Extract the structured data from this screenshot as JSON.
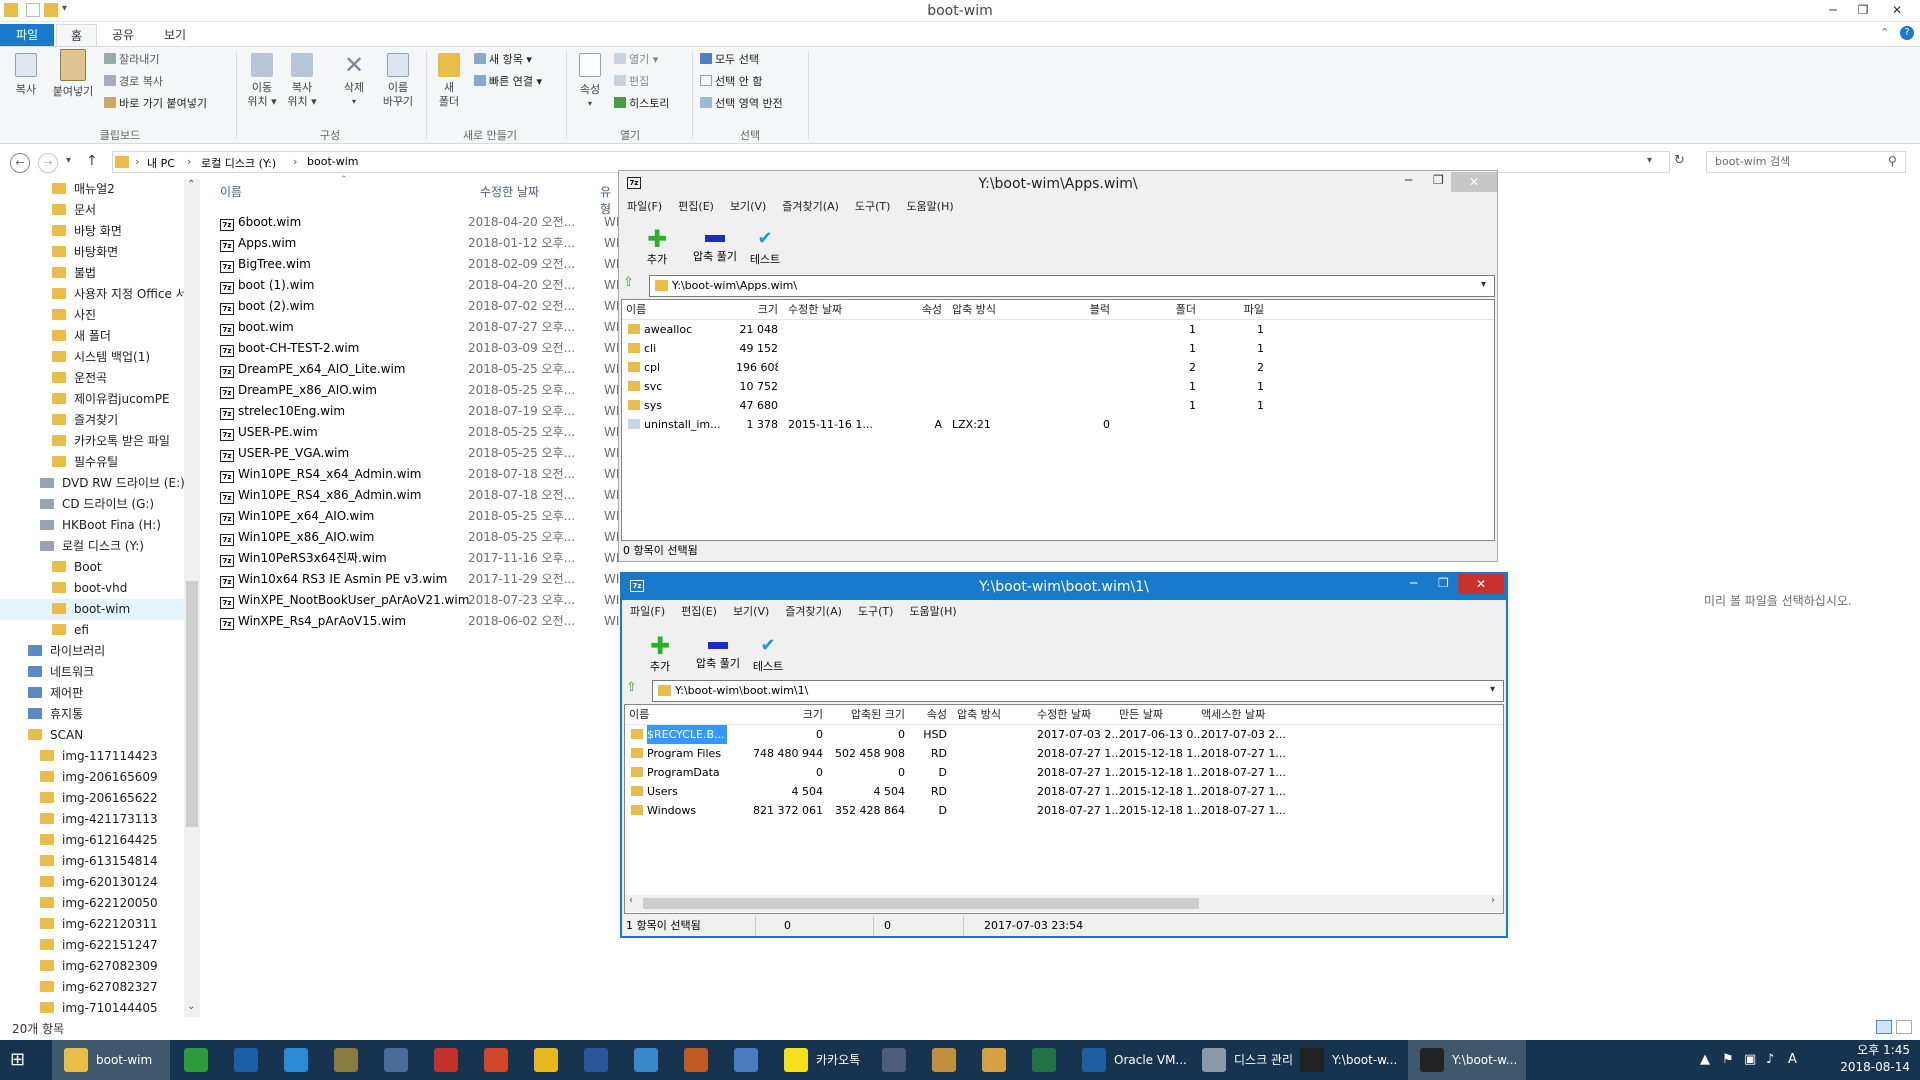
{
  "explorer": {
    "title": "boot-wim",
    "tabs": [
      "파일",
      "홈",
      "공유",
      "보기"
    ],
    "ribbon": {
      "clipboard": {
        "copy": "복사",
        "paste": "붙여넣기",
        "cut": "잘라내기",
        "copy_path": "경로 복사",
        "paste_shortcut": "바로 가기 붙여넣기",
        "group": "클립보드"
      },
      "organize": {
        "move_to": "이동\n위치 ▾",
        "copy_to": "복사\n위치 ▾",
        "delete": "삭제",
        "rename": "이름\n바꾸기",
        "group": "구성"
      },
      "new": {
        "new_folder": "새\n폴더",
        "new_item": "새 항목 ▾",
        "easy_access": "빠른 연결 ▾",
        "group": "새로 만들기"
      },
      "open": {
        "properties": "속성",
        "open": "열기 ▾",
        "edit": "편집",
        "history": "히스토리",
        "group": "열기"
      },
      "select": {
        "select_all": "모두 선택",
        "select_none": "선택 안 함",
        "invert": "선택 영역 반전",
        "group": "선택"
      }
    },
    "address": {
      "crumbs": [
        "내 PC",
        "로컬 디스크 (Y:)",
        "boot-wim"
      ],
      "search_placeholder": "boot-wim 검색"
    },
    "tree": [
      {
        "label": "매뉴얼2",
        "kind": "folder",
        "indent": 1
      },
      {
        "label": "문서",
        "kind": "folder",
        "indent": 1
      },
      {
        "label": "바탕 화면",
        "kind": "folder",
        "indent": 1
      },
      {
        "label": "바탕화면",
        "kind": "folder",
        "indent": 1
      },
      {
        "label": "불법",
        "kind": "folder",
        "indent": 1
      },
      {
        "label": "사용자 지정 Office 서",
        "kind": "folder",
        "indent": 1
      },
      {
        "label": "사진",
        "kind": "folder",
        "indent": 1
      },
      {
        "label": "새 폴더",
        "kind": "folder",
        "indent": 1
      },
      {
        "label": "시스템 백업(1)",
        "kind": "folder",
        "indent": 1
      },
      {
        "label": "운전곡",
        "kind": "folder",
        "indent": 1
      },
      {
        "label": "제이유컴jucomPE",
        "kind": "folder",
        "indent": 1
      },
      {
        "label": "즐겨찾기",
        "kind": "folder",
        "indent": 1
      },
      {
        "label": "카카오톡 받은 파일",
        "kind": "folder",
        "indent": 1
      },
      {
        "label": "필수유틸",
        "kind": "folder",
        "indent": 1
      },
      {
        "label": "DVD RW 드라이브 (E:)",
        "kind": "drive",
        "indent": 0
      },
      {
        "label": "CD 드라이브 (G:)",
        "kind": "drive",
        "indent": 0
      },
      {
        "label": "HKBoot Fina (H:)",
        "kind": "drive",
        "indent": 0
      },
      {
        "label": "로컬 디스크 (Y:)",
        "kind": "drive",
        "indent": 0
      },
      {
        "label": "Boot",
        "kind": "folder",
        "indent": 1
      },
      {
        "label": "boot-vhd",
        "kind": "folder",
        "indent": 1
      },
      {
        "label": "boot-wim",
        "kind": "folder",
        "indent": 1,
        "selected": true
      },
      {
        "label": "efi",
        "kind": "folder",
        "indent": 1
      },
      {
        "label": "라이브러리",
        "kind": "lib",
        "indent": -1
      },
      {
        "label": "네트워크",
        "kind": "lib",
        "indent": -1
      },
      {
        "label": "제어판",
        "kind": "lib",
        "indent": -1
      },
      {
        "label": "휴지통",
        "kind": "lib",
        "indent": -1
      },
      {
        "label": "SCAN",
        "kind": "folder",
        "indent": -1
      },
      {
        "label": "img-117114423",
        "kind": "folder",
        "indent": 0
      },
      {
        "label": "img-206165609",
        "kind": "folder",
        "indent": 0
      },
      {
        "label": "img-206165622",
        "kind": "folder",
        "indent": 0
      },
      {
        "label": "img-421173113",
        "kind": "folder",
        "indent": 0
      },
      {
        "label": "img-612164425",
        "kind": "folder",
        "indent": 0
      },
      {
        "label": "img-613154814",
        "kind": "folder",
        "indent": 0
      },
      {
        "label": "img-620130124",
        "kind": "folder",
        "indent": 0
      },
      {
        "label": "img-622120050",
        "kind": "folder",
        "indent": 0
      },
      {
        "label": "img-622120311",
        "kind": "folder",
        "indent": 0
      },
      {
        "label": "img-622151247",
        "kind": "folder",
        "indent": 0
      },
      {
        "label": "img-627082309",
        "kind": "folder",
        "indent": 0
      },
      {
        "label": "img-627082327",
        "kind": "folder",
        "indent": 0
      },
      {
        "label": "img-710144405",
        "kind": "folder",
        "indent": 0
      }
    ],
    "list_headers": {
      "name": "이름",
      "date": "수정한 날짜",
      "type": "유형"
    },
    "files": [
      {
        "name": "6boot.wim",
        "date": "2018-04-20 오전...",
        "type": "WI"
      },
      {
        "name": "Apps.wim",
        "date": "2018-01-12 오후...",
        "type": "WI"
      },
      {
        "name": "BigTree.wim",
        "date": "2018-02-09 오전...",
        "type": "WI"
      },
      {
        "name": "boot (1).wim",
        "date": "2018-04-20 오전...",
        "type": "WI"
      },
      {
        "name": "boot (2).wim",
        "date": "2018-07-02 오전...",
        "type": "WI"
      },
      {
        "name": "boot.wim",
        "date": "2018-07-27 오후...",
        "type": "WI"
      },
      {
        "name": "boot-CH-TEST-2.wim",
        "date": "2018-03-09 오전...",
        "type": "WI"
      },
      {
        "name": "DreamPE_x64_AIO_Lite.wim",
        "date": "2018-05-25 오후...",
        "type": "WI"
      },
      {
        "name": "DreamPE_x86_AIO.wim",
        "date": "2018-05-25 오후...",
        "type": "WI"
      },
      {
        "name": "strelec10Eng.wim",
        "date": "2018-07-19 오후...",
        "type": "WI"
      },
      {
        "name": "USER-PE.wim",
        "date": "2018-05-25 오후...",
        "type": "WI"
      },
      {
        "name": "USER-PE_VGA.wim",
        "date": "2018-05-25 오후...",
        "type": "WI"
      },
      {
        "name": "Win10PE_RS4_x64_Admin.wim",
        "date": "2018-07-18 오전...",
        "type": "WI"
      },
      {
        "name": "Win10PE_RS4_x86_Admin.wim",
        "date": "2018-07-18 오전...",
        "type": "WI"
      },
      {
        "name": "Win10PE_x64_AIO.wim",
        "date": "2018-05-25 오후...",
        "type": "WI"
      },
      {
        "name": "Win10PE_x86_AIO.wim",
        "date": "2018-05-25 오후...",
        "type": "WI"
      },
      {
        "name": "Win10PeRS3x64진짜.wim",
        "date": "2017-11-16 오후...",
        "type": "WI"
      },
      {
        "name": "Win10x64 RS3 IE Asmin PE v3.wim",
        "date": "2017-11-29 오전...",
        "type": "WI"
      },
      {
        "name": "WinXPE_NootBookUser_pArAoV21.wim",
        "date": "2018-07-23 오후...",
        "type": "WI"
      },
      {
        "name": "WinXPE_Rs4_pArAoV15.wim",
        "date": "2018-06-02 오전...",
        "type": "WI"
      }
    ],
    "status": "20개 항목",
    "preview_text": "미리 볼 파일을 선택하십시오."
  },
  "zip1": {
    "title": "Y:\\boot-wim\\Apps.wim\\",
    "menu": [
      "파일(F)",
      "편집(E)",
      "보기(V)",
      "즐겨찾기(A)",
      "도구(T)",
      "도움말(H)"
    ],
    "toolbar": {
      "add": "추가",
      "extract": "압축 풀기",
      "test": "테스트"
    },
    "path": "Y:\\boot-wim\\Apps.wim\\",
    "headers": {
      "name": "이름",
      "size": "크기",
      "mtime": "수정한 날짜",
      "attr": "속성",
      "method": "압축 방식",
      "block": "블럭",
      "folders": "폴더",
      "files": "파일"
    },
    "rows": [
      {
        "name": "awealloc",
        "size": "21 048",
        "mtime": "",
        "attr": "",
        "method": "",
        "block": "",
        "folders": "1",
        "files": "1"
      },
      {
        "name": "cli",
        "size": "49 152",
        "mtime": "",
        "attr": "",
        "method": "",
        "block": "",
        "folders": "1",
        "files": "1"
      },
      {
        "name": "cpl",
        "size": "196 608",
        "mtime": "",
        "attr": "",
        "method": "",
        "block": "",
        "folders": "2",
        "files": "2"
      },
      {
        "name": "svc",
        "size": "10 752",
        "mtime": "",
        "attr": "",
        "method": "",
        "block": "",
        "folders": "1",
        "files": "1"
      },
      {
        "name": "sys",
        "size": "47 680",
        "mtime": "",
        "attr": "",
        "method": "",
        "block": "",
        "folders": "1",
        "files": "1"
      },
      {
        "name": "uninstall_im...",
        "size": "1 378",
        "mtime": "2015-11-16 1...",
        "attr": "A",
        "method": "LZX:21",
        "block": "0",
        "folders": "",
        "files": ""
      }
    ],
    "status": "0 항목이 선택됨"
  },
  "zip2": {
    "title": "Y:\\boot-wim\\boot.wim\\1\\",
    "menu": [
      "파일(F)",
      "편집(E)",
      "보기(V)",
      "즐겨찾기(A)",
      "도구(T)",
      "도움말(H)"
    ],
    "toolbar": {
      "add": "추가",
      "extract": "압축 풀기",
      "test": "테스트"
    },
    "path": "Y:\\boot-wim\\boot.wim\\1\\",
    "headers": {
      "name": "이름",
      "size": "크기",
      "packed": "압축된 크기",
      "attr": "속성",
      "method": "압축 방식",
      "mtime": "수정한 날짜",
      "ctime": "만든 날짜",
      "atime": "액세스한 날짜"
    },
    "rows": [
      {
        "name": "$RECYCLE.B...",
        "size": "0",
        "packed": "0",
        "attr": "HSD",
        "method": "",
        "mtime": "2017-07-03 2...",
        "ctime": "2017-06-13 0...",
        "atime": "2017-07-03 2..."
      },
      {
        "name": "Program Files",
        "size": "748 480 944",
        "packed": "502 458 908",
        "attr": "RD",
        "method": "",
        "mtime": "2018-07-27 1...",
        "ctime": "2015-12-18 1...",
        "atime": "2018-07-27 1..."
      },
      {
        "name": "ProgramData",
        "size": "0",
        "packed": "0",
        "attr": "D",
        "method": "",
        "mtime": "2018-07-27 1...",
        "ctime": "2015-12-18 1...",
        "atime": "2018-07-27 1..."
      },
      {
        "name": "Users",
        "size": "4 504",
        "packed": "4 504",
        "attr": "RD",
        "method": "",
        "mtime": "2018-07-27 1...",
        "ctime": "2015-12-18 1...",
        "atime": "2018-07-27 1..."
      },
      {
        "name": "Windows",
        "size": "821 372 061",
        "packed": "352 428 864",
        "attr": "D",
        "method": "",
        "mtime": "2018-07-27 1...",
        "ctime": "2015-12-18 1...",
        "atime": "2018-07-27 1..."
      }
    ],
    "status": [
      "1 항목이 선택됨",
      "0",
      "0",
      "2017-07-03 23:54"
    ]
  },
  "taskbar": {
    "items": [
      {
        "label": "boot-wim",
        "icon": "folder-icon",
        "color": "#e8bd4a"
      },
      {
        "label": "",
        "icon": "store-icon",
        "color": "#2e9c3c"
      },
      {
        "label": "",
        "icon": "help-icon",
        "color": "#1b5fa8"
      },
      {
        "label": "",
        "icon": "ie-icon",
        "color": "#2a8ad8"
      },
      {
        "label": "",
        "icon": "box-icon",
        "color": "#8a7a40"
      },
      {
        "label": "",
        "icon": "person-icon",
        "color": "#4a6b9a"
      },
      {
        "label": "",
        "icon": "acrobat-icon",
        "color": "#c3312b"
      },
      {
        "label": "",
        "icon": "powerpoint-icon",
        "color": "#d24726"
      },
      {
        "label": "",
        "icon": "chrome-icon",
        "color": "#e6b91e"
      },
      {
        "label": "",
        "icon": "word-icon",
        "color": "#2b579a"
      },
      {
        "label": "",
        "icon": "notepad-icon",
        "color": "#3b86c6"
      },
      {
        "label": "",
        "icon": "winamp-icon",
        "color": "#c05a20"
      },
      {
        "label": "",
        "icon": "network-icon",
        "color": "#4a7ac0"
      },
      {
        "label": "카카오톡",
        "icon": "kakaotalk-icon",
        "color": "#f7e11b"
      },
      {
        "label": "",
        "icon": "media-icon",
        "color": "#4c5d7a"
      },
      {
        "label": "",
        "icon": "user-icon",
        "color": "#c09040"
      },
      {
        "label": "",
        "icon": "user2-icon",
        "color": "#d4a040"
      },
      {
        "label": "",
        "icon": "excel-icon",
        "color": "#217346"
      },
      {
        "label": "Oracle VM...",
        "icon": "virtualbox-icon",
        "color": "#1d5fa0"
      },
      {
        "label": "디스크 관리",
        "icon": "disk-icon",
        "color": "#8a9aa8"
      },
      {
        "label": "Y:\\boot-w...",
        "icon": "7zip-icon",
        "color": "#222222"
      },
      {
        "label": "Y:\\boot-w...",
        "icon": "7zip-icon",
        "color": "#222222"
      }
    ],
    "clock_time": "오후 1:45",
    "clock_date": "2018-08-14",
    "tray": [
      "▲",
      "⚑",
      "▣",
      "♪",
      "A"
    ]
  }
}
